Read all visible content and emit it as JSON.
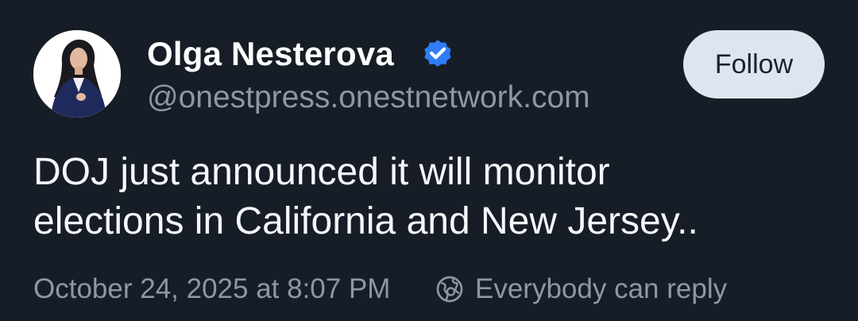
{
  "author": {
    "display_name": "Olga Nesterova",
    "handle": "@onestpress.onestnetwork.com",
    "verified": true,
    "avatar": "profile-photo"
  },
  "actions": {
    "follow_label": "Follow"
  },
  "post": {
    "text_line1": "DOJ just announced it will monitor",
    "text_line2": "elections in California and New Jersey.."
  },
  "meta": {
    "timestamp": "October 24, 2025 at 8:07 PM",
    "reply_setting": "Everybody can reply",
    "reply_icon": "globe-icon"
  },
  "colors": {
    "background": "#171d26",
    "verified_badge": "#2f7df6",
    "muted_text": "#8b98a8",
    "follow_button": "#dfe5ee"
  }
}
